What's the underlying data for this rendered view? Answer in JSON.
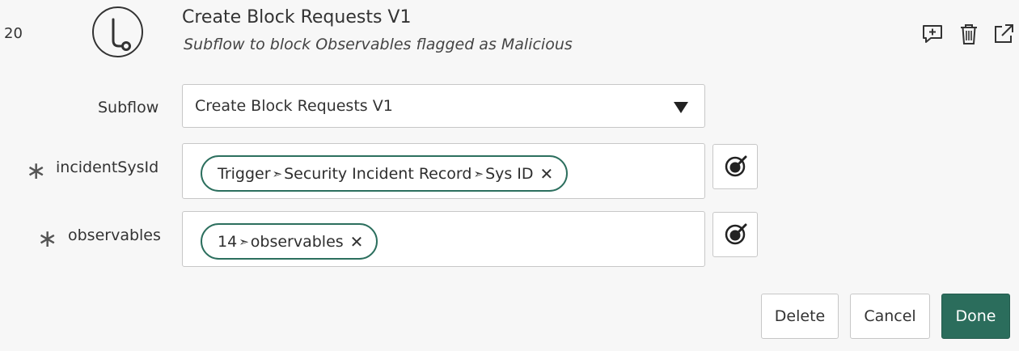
{
  "step": {
    "number": "20",
    "icon": "subflow-icon",
    "title": "Create Block Requests V1",
    "subtitle": "Subflow to block Observables flagged as Malicious"
  },
  "header_actions": [
    {
      "name": "add-comment",
      "icon": "comment-plus-icon"
    },
    {
      "name": "delete-step",
      "icon": "trash-icon"
    },
    {
      "name": "open-external",
      "icon": "external-link-icon"
    }
  ],
  "fields": {
    "subflow": {
      "label": "Subflow",
      "value": "Create Block Requests V1"
    },
    "incident": {
      "label": "incidentSysId",
      "required": true,
      "pill_parts": [
        "Trigger",
        "Security Incident Record",
        "Sys ID"
      ]
    },
    "observables": {
      "label": "observables",
      "required": true,
      "pill_parts": [
        "14",
        "observables"
      ]
    }
  },
  "glyphs": {
    "required": "∗",
    "separator": "➣",
    "remove": "✕"
  },
  "buttons": {
    "delete": "Delete",
    "cancel": "Cancel",
    "done": "Done"
  },
  "colors": {
    "accent": "#2b6d5c",
    "pill_border": "#2c6f5e",
    "background": "#f7f7f7"
  }
}
